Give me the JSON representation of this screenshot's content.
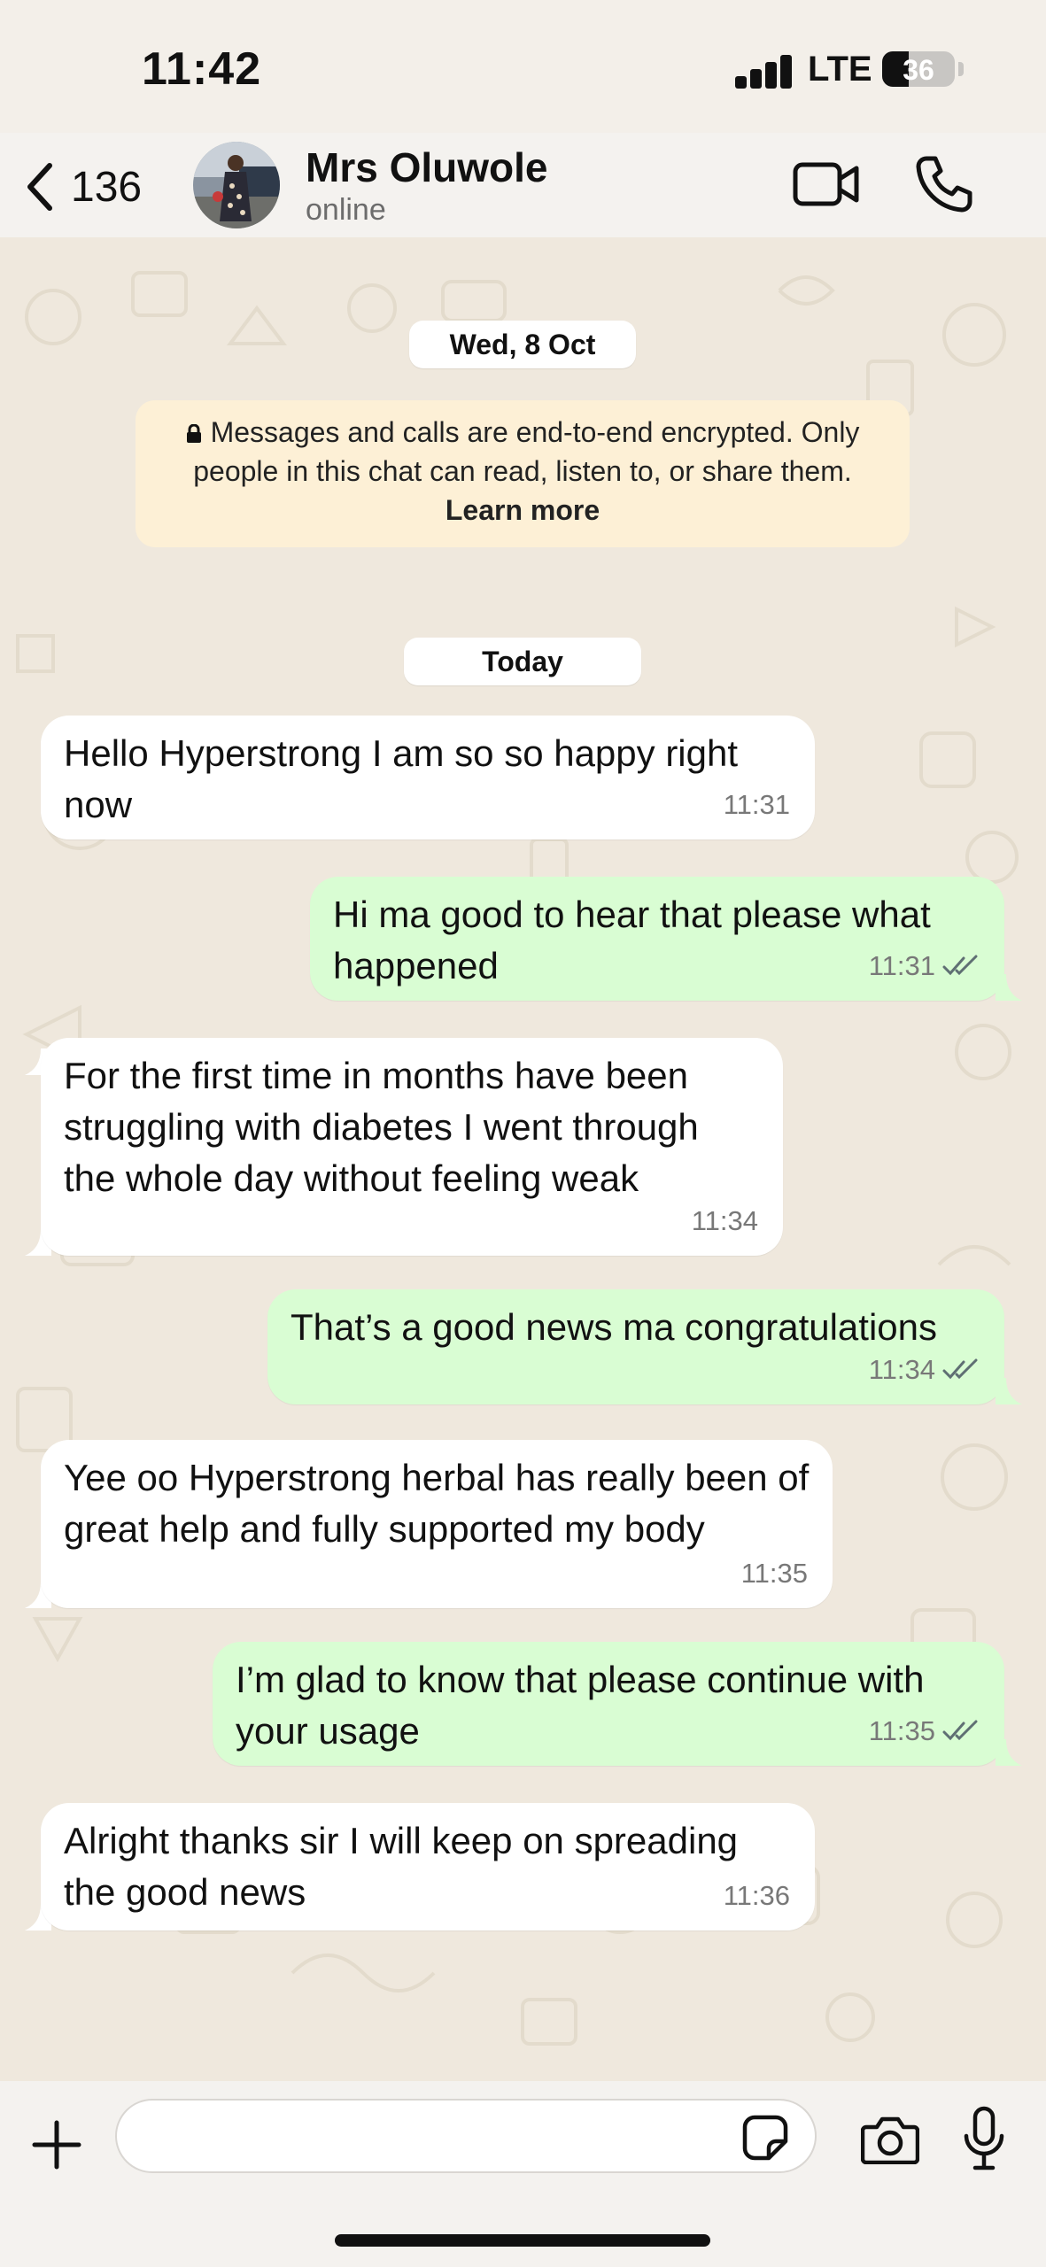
{
  "status_bar": {
    "time": "11:42",
    "network": "LTE",
    "battery_level": "36",
    "battery_fraction": 0.36
  },
  "header": {
    "back_count": "136",
    "contact_name": "Mrs Oluwole",
    "contact_status": "online",
    "icons": {
      "back": "chevron-left-icon",
      "video": "video-call-icon",
      "call": "phone-icon"
    }
  },
  "chat": {
    "date_separators": [
      "Wed, 8 Oct",
      "Today"
    ],
    "encryption_notice": {
      "text": "Messages and calls are end-to-end encrypted. Only people in this chat can read, listen to, or share them.",
      "link": "Learn more"
    },
    "messages": [
      {
        "direction": "incoming",
        "text": "Hello Hyperstrong I am so so happy right now",
        "time": "11:31"
      },
      {
        "direction": "outgoing",
        "text": "Hi ma good to hear that please what happened",
        "time": "11:31",
        "status": "read"
      },
      {
        "direction": "incoming",
        "text": "For the first time in months have been struggling with diabetes I went through the whole day without feeling weak",
        "time": "11:34"
      },
      {
        "direction": "outgoing",
        "text": "That’s a good news ma congratulations",
        "time": "11:34",
        "status": "read"
      },
      {
        "direction": "incoming",
        "text": "Yee oo Hyperstrong herbal has really been of great help and fully supported my body",
        "time": "11:35"
      },
      {
        "direction": "outgoing",
        "text": "I’m glad to know that please continue with your usage",
        "time": "11:35",
        "status": "read"
      },
      {
        "direction": "incoming",
        "text": "Alright thanks sir I will keep on spreading the good news",
        "time": "11:36"
      }
    ]
  },
  "composer": {
    "placeholder": "",
    "icons": {
      "attach": "plus-icon",
      "sticker": "sticker-icon",
      "camera": "camera-icon",
      "mic": "microphone-icon"
    }
  },
  "colors": {
    "incoming_bubble": "#ffffff",
    "outgoing_bubble": "#d9fdd3",
    "read_ticks": "#53bdeb",
    "notice_bg": "#fdf0d6"
  }
}
